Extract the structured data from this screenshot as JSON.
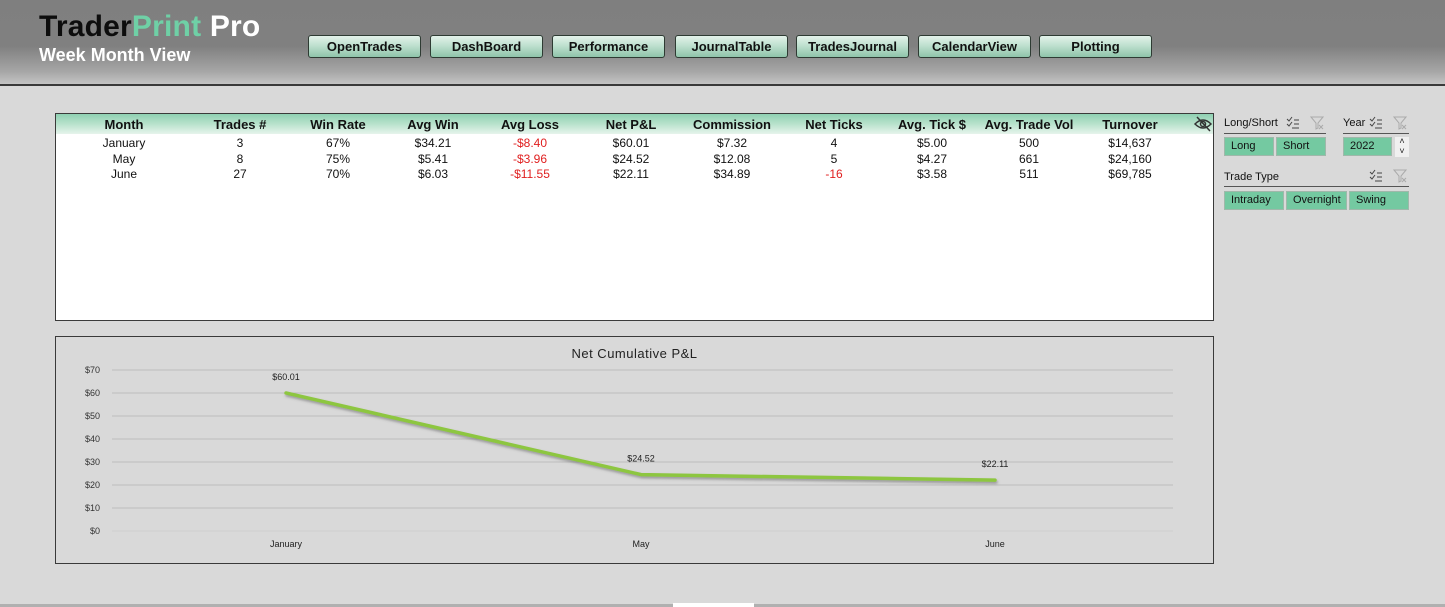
{
  "header": {
    "brand_part1": "Trader",
    "brand_part2": "Print",
    "brand_part3": "Pro",
    "subtitle": "Week Month View",
    "nav": [
      "OpenTrades",
      "DashBoard",
      "Performance",
      "JournalTable",
      "TradesJournal",
      "CalendarView",
      "Plotting"
    ]
  },
  "table": {
    "columns": [
      "Month",
      "Trades #",
      "Win Rate",
      "Avg Win",
      "Avg Loss",
      "Net P&L",
      "Commission",
      "Net Ticks",
      "Avg. Tick $",
      "Avg. Trade Vol",
      "Turnover"
    ],
    "rows": [
      [
        "January",
        "3",
        "67%",
        "$34.21",
        "-$8.40",
        "$60.01",
        "$7.32",
        "4",
        "$5.00",
        "500",
        "$14,637"
      ],
      [
        "May",
        "8",
        "75%",
        "$5.41",
        "-$3.96",
        "$24.52",
        "$12.08",
        "5",
        "$4.27",
        "661",
        "$24,160"
      ],
      [
        "June",
        "27",
        "70%",
        "$6.03",
        "-$11.55",
        "$22.11",
        "$34.89",
        "-16",
        "$3.58",
        "511",
        "$69,785"
      ]
    ],
    "hide_icon": "eye-slash-icon"
  },
  "slicers": {
    "long_short": {
      "title": "Long/Short",
      "items": [
        "Long",
        "Short"
      ]
    },
    "year": {
      "title": "Year",
      "items": [
        "2022"
      ]
    },
    "trade_type": {
      "title": "Trade Type",
      "items": [
        "Intraday",
        "Overnight",
        "Swing"
      ]
    },
    "multi_select_icon": "multi-select-icon",
    "clear_filter_icon": "clear-filter-icon",
    "spin_up": "˄",
    "spin_down": "˅"
  },
  "colors": {
    "accent_green": "#74c9a1",
    "brand_green": "#6fd0a6",
    "negative_red": "#e02020",
    "line_green": "#8dc63f"
  },
  "chart_data": {
    "type": "line",
    "title": "Net Cumulative P&L",
    "categories": [
      "January",
      "May",
      "June"
    ],
    "series": [
      {
        "name": "Net Cumulative P&L",
        "values": [
          60.01,
          24.52,
          22.11
        ]
      }
    ],
    "data_labels": [
      "$60.01",
      "$24.52",
      "$22.11"
    ],
    "y_ticks": [
      "$0",
      "$10",
      "$20",
      "$30",
      "$40",
      "$50",
      "$60",
      "$70"
    ],
    "ylim": [
      0,
      70
    ],
    "xlabel": "",
    "ylabel": "",
    "grid": true,
    "legend": "none"
  }
}
